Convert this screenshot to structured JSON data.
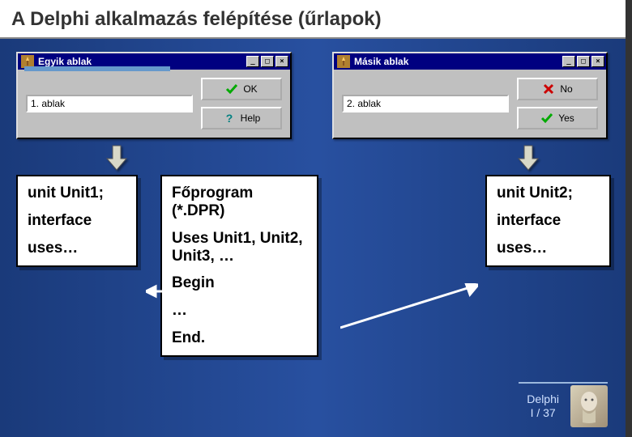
{
  "title": "A Delphi alkalmazás felépítése (űrlapok)",
  "window1": {
    "caption": "Egyik ablak",
    "input": "1. ablak",
    "btn_ok": "OK",
    "btn_help": "Help"
  },
  "window2": {
    "caption": "Másik ablak",
    "input": "2. ablak",
    "btn_no": "No",
    "btn_yes": "Yes"
  },
  "unit1": {
    "l1": "unit Unit1;",
    "l2": "interface",
    "l3": "uses…"
  },
  "main": {
    "l1": "Főprogram (*.DPR)",
    "l2": "Uses Unit1, Unit2, Unit3, …",
    "l3": "Begin",
    "l4": "…",
    "l5": "End."
  },
  "unit2": {
    "l1": "unit Unit2;",
    "l2": "interface",
    "l3": "uses…"
  },
  "footer": {
    "line1": "Delphi",
    "line2": "I / 37"
  }
}
